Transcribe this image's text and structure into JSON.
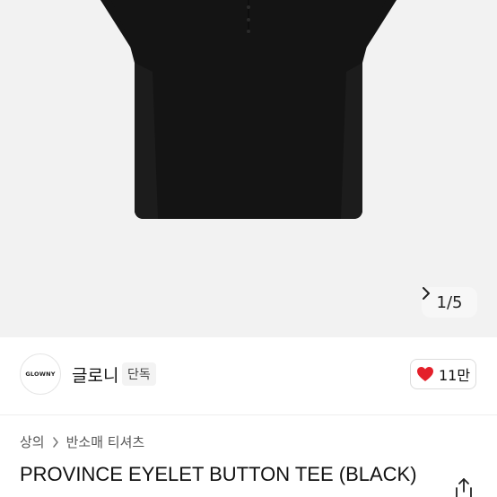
{
  "gallery": {
    "pager_text": "1/5",
    "background": "#f2f2f2",
    "product_color": "#141414"
  },
  "brand": {
    "logo_text": "GLOWNY",
    "name": "글로니",
    "exclusive_badge": "단독",
    "like_count": "11만",
    "heart_color": "#e4202a"
  },
  "breadcrumb": {
    "items": [
      "상의",
      "반소매 티셔츠"
    ]
  },
  "product": {
    "title": "PROVINCE EYELET BUTTON TEE (BLACK)"
  },
  "icons": {
    "heart": "heart-icon",
    "share": "share-icon",
    "chevron": "chevron-right-icon"
  }
}
